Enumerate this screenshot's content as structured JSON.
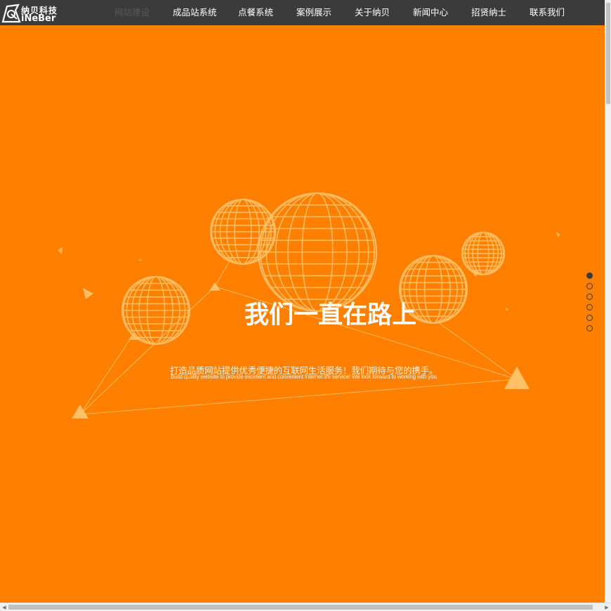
{
  "logo": {
    "cn": "纳贝科技",
    "en": "iNeBer"
  },
  "nav": {
    "items": [
      "网站建设",
      "成品站系统",
      "点餐系统",
      "案例展示",
      "关于纳贝",
      "新闻中心",
      "招贤纳士",
      "联系我们"
    ],
    "active_index": 0
  },
  "hero": {
    "headline": "我们一直在路上",
    "subtitle_cn": "打造品质网站提供优秀便捷的互联网生活服务！我们期待与您的携手。",
    "subtitle_en": "Build quality website to provide excellent and convenient Internet life service! We look forward to working with you"
  },
  "slides": {
    "count": 6,
    "active_index": 0
  },
  "colors": {
    "background": "#ff8000",
    "topbar": "#3b3b3b",
    "graphic": "#ffc36b"
  },
  "icons": {
    "scroll_left": "scroll-left-arrow-icon",
    "scroll_right": "scroll-right-arrow-icon"
  }
}
